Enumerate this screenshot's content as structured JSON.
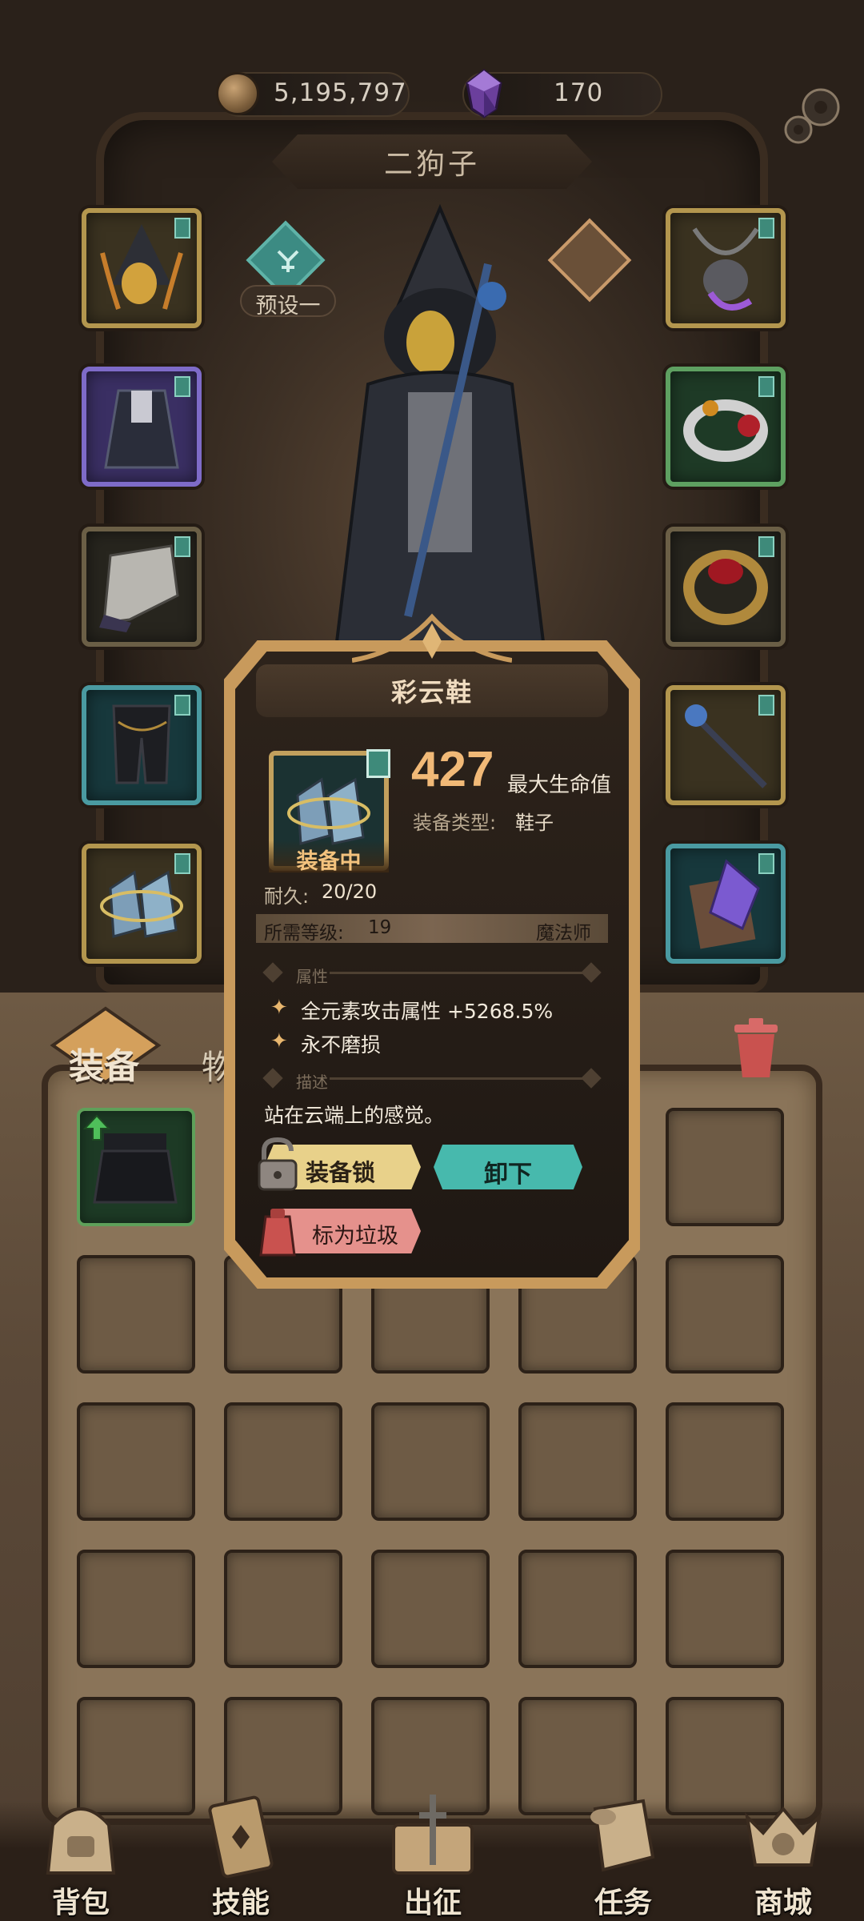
{
  "currency": {
    "gold": "5,195,797",
    "gems": "170"
  },
  "character": {
    "name": "二狗子",
    "preset_label": "预设一"
  },
  "equipment_slots": {
    "left": [
      "head",
      "body",
      "arms",
      "legs",
      "feet"
    ],
    "right": [
      "amulet",
      "ring-1",
      "ring-2",
      "weapon",
      "offhand"
    ]
  },
  "tabs": {
    "equipment": "装备",
    "items": "物品"
  },
  "popup": {
    "title": "彩云鞋",
    "equipped_badge": "装备中",
    "stat_value": "427",
    "stat_name": "最大生命值",
    "type_label": "装备类型:",
    "type_value": "鞋子",
    "durability_label": "耐久:",
    "durability_value": "20/20",
    "requirement_label": "所需等级:",
    "requirement_level": "19",
    "requirement_class": "魔法师",
    "attributes_header": "属性",
    "attributes": [
      "全元素攻击属性 +5268.5%",
      "永不磨损"
    ],
    "description_header": "描述",
    "description": "站在云端上的感觉。",
    "lock_button": "装备锁",
    "unequip_button": "卸下",
    "junk_button": "标为垃圾"
  },
  "nav": {
    "bag": "背包",
    "skills": "技能",
    "expedition": "出征",
    "quests": "任务",
    "shop": "商城"
  },
  "colors": {
    "accent_gold": "#f1b977",
    "teal_button": "#47b9ad",
    "lock_button": "#e8d18a",
    "junk_button": "#e5918c"
  },
  "icons": [
    "coin-icon",
    "gem-icon",
    "gear-icon",
    "preset-icon",
    "trash-icon",
    "lock-icon",
    "junk-tag-icon",
    "upgrade-arrow-icon"
  ]
}
